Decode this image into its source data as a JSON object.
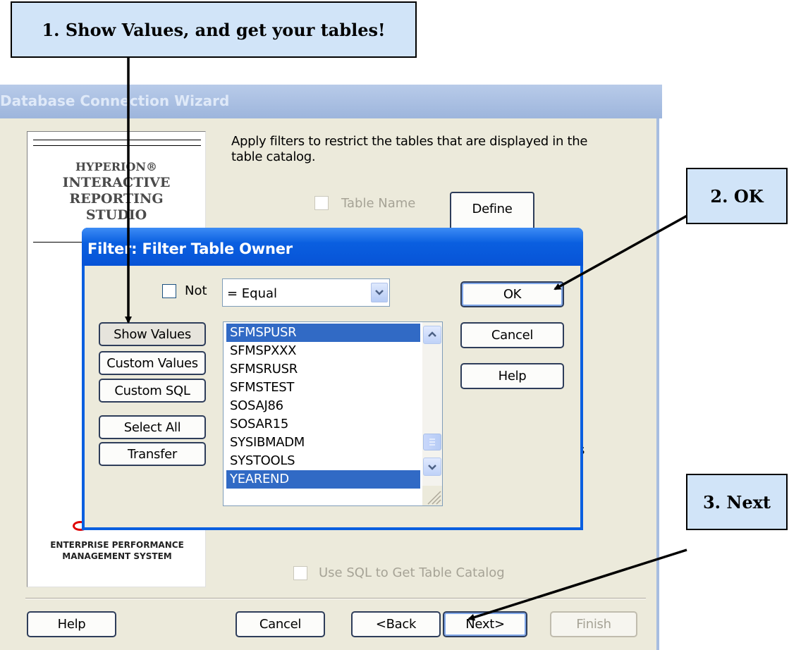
{
  "callouts": {
    "step1": "1.  Show Values, and get your tables!",
    "step2": "2.  OK",
    "step3": "3.  Next"
  },
  "wizard": {
    "title": "Database Connection Wizard",
    "description": "Apply filters to restrict the tables that are displayed in the table catalog.",
    "logo_lines": [
      "HYPERION®",
      "INTERACTIVE",
      "REPORTING",
      "STUDIO"
    ],
    "logo_footer_1": "ENTERPRISE PERFORMANCE",
    "logo_footer_2": "MANAGEMENT SYSTEM",
    "table_name_label": "Table Name",
    "define_label": "Define",
    "use_sql_label": "Use SQL to Get Table Catalog",
    "buttons": {
      "help": "Help",
      "cancel": "Cancel",
      "back": "<Back",
      "next": "Next>",
      "finish": "Finish"
    }
  },
  "filter_dialog": {
    "title": "Filter: Filter Table Owner",
    "not_label": "Not",
    "operator_selected": "= Equal",
    "left_buttons": [
      "Show Values",
      "Custom Values",
      "Custom SQL",
      "Select All",
      "Transfer"
    ],
    "values": [
      {
        "text": "SFMSPUSR",
        "selected": true
      },
      {
        "text": "SFMSPXXX",
        "selected": false
      },
      {
        "text": "SFMSRUSR",
        "selected": false
      },
      {
        "text": "SFMSTEST",
        "selected": false
      },
      {
        "text": "SOSAJ86",
        "selected": false
      },
      {
        "text": "SOSAR15",
        "selected": false
      },
      {
        "text": "SYSIBMADM",
        "selected": false
      },
      {
        "text": "SYSTOOLS",
        "selected": false
      },
      {
        "text": "YEAREND",
        "selected": true
      }
    ],
    "right_buttons": {
      "ok": "OK",
      "cancel": "Cancel",
      "help": "Help"
    }
  },
  "colors": {
    "dialog_title_bar": "#0a5fe0",
    "wizard_title_bar": "#a7bde0",
    "dialog_body": "#ece9d8",
    "selection": "#316ac5",
    "callout_fill": "#d1e4f8"
  }
}
